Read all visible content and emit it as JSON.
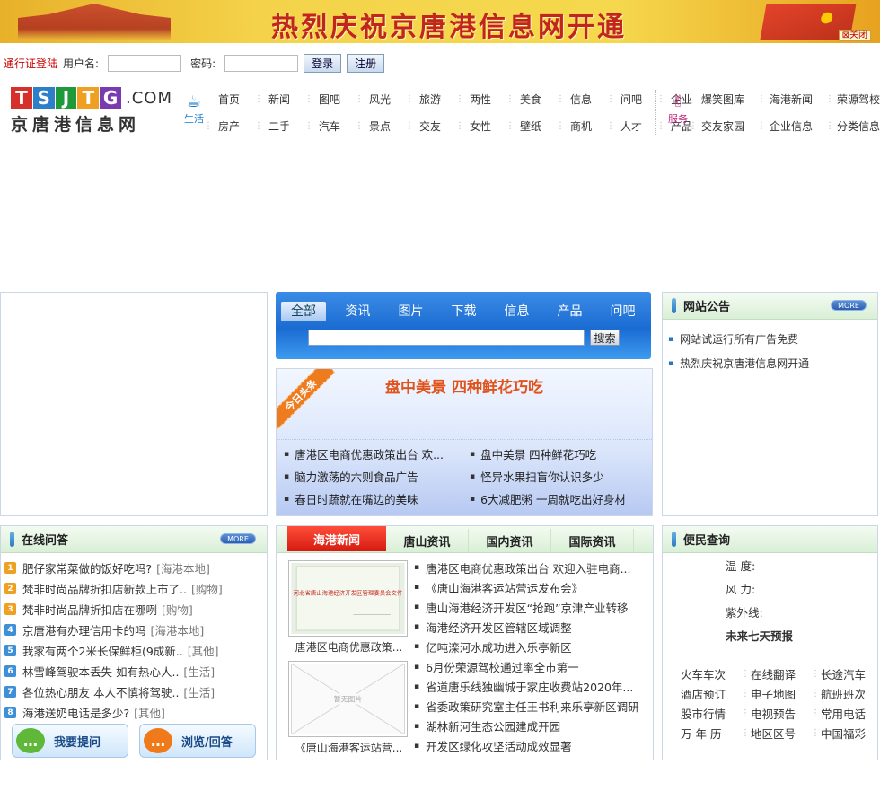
{
  "banner": {
    "title": "热烈庆祝京唐港信息网开通",
    "close_label": "关闭"
  },
  "login": {
    "pass_label": "通行证登陆",
    "username_label": "用户名:",
    "password_label": "密码:",
    "login_button": "登录",
    "register_button": "注册"
  },
  "logo": {
    "letters": [
      "T",
      "S",
      "J",
      "T",
      "G"
    ],
    "letter_colors": [
      "#d5312a",
      "#2d7fc9",
      "#1f9a3a",
      "#f0a020",
      "#7a3bb0"
    ],
    "domain": ".COM",
    "name_cn": "京唐港信息网"
  },
  "nav": {
    "life_label": "生活",
    "service_label": "服务",
    "life_row1": [
      "首页",
      "新闻",
      "图吧",
      "风光",
      "旅游",
      "两性",
      "美食",
      "信息",
      "问吧",
      "企业"
    ],
    "life_row2": [
      "房产",
      "二手",
      "汽车",
      "景点",
      "交友",
      "女性",
      "壁纸",
      "商机",
      "人才",
      "产品"
    ],
    "serve_row1": [
      "爆笑图库",
      "海港新闻",
      "荣源驾校"
    ],
    "serve_row2": [
      "交友家园",
      "企业信息",
      "分类信息"
    ]
  },
  "search": {
    "tabs": [
      "全部",
      "资讯",
      "图片",
      "下载",
      "信息",
      "产品",
      "问吧"
    ],
    "active_tab": "全部",
    "button": "搜索"
  },
  "headline": {
    "ribbon": "今日头条",
    "title": "盘中美景 四种鲜花巧吃",
    "items": [
      "唐港区电商优惠政策出台 欢...",
      "盘中美景 四种鲜花巧吃",
      "脑力激荡的六则食品广告",
      "怪异水果扫盲你认识多少",
      "春日时蔬就在嘴边的美味",
      "6大减肥粥 一周就吃出好身材"
    ]
  },
  "notice": {
    "title": "网站公告",
    "more": "MORE",
    "items": [
      "网站试运行所有广告免费",
      "热烈庆祝京唐港信息网开通"
    ]
  },
  "qa": {
    "title": "在线问答",
    "more": "MORE",
    "items": [
      {
        "n": "1",
        "q": "肥仔家常菜做的饭好吃吗?",
        "cat": "[海港本地]",
        "color": "#f0a020"
      },
      {
        "n": "2",
        "q": "梵非时尚品牌折扣店新款上市了..",
        "cat": "[购物]",
        "color": "#f0a020"
      },
      {
        "n": "3",
        "q": "梵非时尚品牌折扣店在哪咧",
        "cat": "[购物]",
        "color": "#f0a020"
      },
      {
        "n": "4",
        "q": "京唐港有办理信用卡的吗",
        "cat": "[海港本地]",
        "color": "#3d8fd8"
      },
      {
        "n": "5",
        "q": "我家有两个2米长保鲜柜(9成新..",
        "cat": "[其他]",
        "color": "#3d8fd8"
      },
      {
        "n": "6",
        "q": "林雪峰驾驶本丢失 如有热心人..",
        "cat": "[生活]",
        "color": "#3d8fd8"
      },
      {
        "n": "7",
        "q": "各位热心朋友 本人不慎将驾驶..",
        "cat": "[生活]",
        "color": "#3d8fd8"
      },
      {
        "n": "8",
        "q": "海港送奶电话是多少?",
        "cat": "[其他]",
        "color": "#3d8fd8"
      }
    ],
    "ask_button": "我要提问",
    "browse_button": "浏览/回答"
  },
  "news": {
    "tabs": [
      "海港新闻",
      "唐山资讯",
      "国内资讯",
      "国际资讯"
    ],
    "active_tab": "海港新闻",
    "thumb1_caption": "唐港区电商优惠政策...",
    "thumb1_doc_title": "河北省唐山海港经济开发区管理委员会文件",
    "thumb2_caption": "《唐山海港客运站营...",
    "thumb2_placeholder": "暂无图片",
    "items": [
      "唐港区电商优惠政策出台 欢迎入驻电商...",
      "《唐山海港客运站营运发布会》",
      "唐山海港经济开发区“抢跑”京津产业转移",
      "海港经济开发区管辖区域调整",
      "亿吨滦河水成功进入乐亭新区",
      "6月份荣源驾校通过率全市第一",
      "省道唐乐线独幽城于家庄收费站2020年...",
      "省委政策研究室主任王书利来乐亭新区调研",
      "湖林新河生态公园建成开园",
      "开发区绿化攻坚活动成效显著"
    ]
  },
  "convenience": {
    "title": "便民查询",
    "temp_label": "温  度:",
    "wind_label": "风  力:",
    "uv_label": "紫外线:",
    "forecast_label": "未来七天预报",
    "links": [
      [
        "火车车次",
        "在线翻译",
        "长途汽车"
      ],
      [
        "酒店预订",
        "电子地图",
        "航班班次"
      ],
      [
        "股市行情",
        "电视预告",
        "常用电话"
      ],
      [
        "万 年 历",
        "地区区号",
        "中国福彩"
      ]
    ]
  },
  "colors": {
    "accent_blue": "#1b6cd2",
    "tab_red": "#d61b10",
    "headline_orange": "#e0531a",
    "login_red": "#cc0000"
  }
}
